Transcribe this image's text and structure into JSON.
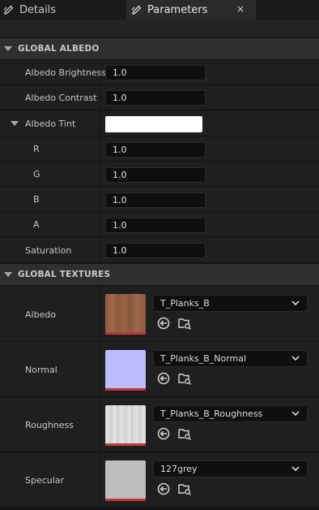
{
  "tabs": [
    {
      "label": "Details",
      "icon": "pencil-icon"
    },
    {
      "label": "Parameters",
      "icon": "pencil-icon",
      "close": "×"
    }
  ],
  "sections": {
    "albedo": {
      "title": "GLOBAL ALBEDO"
    },
    "textures": {
      "title": "GLOBAL TEXTURES"
    }
  },
  "albedo": {
    "brightness": {
      "label": "Albedo Brightness",
      "value": "1.0"
    },
    "contrast": {
      "label": "Albedo Contrast",
      "value": "1.0"
    },
    "tint": {
      "label": "Albedo Tint",
      "color": "#ffffff",
      "channels": [
        {
          "label": "R",
          "value": "1.0"
        },
        {
          "label": "G",
          "value": "1.0"
        },
        {
          "label": "B",
          "value": "1.0"
        },
        {
          "label": "A",
          "value": "1.0"
        }
      ]
    },
    "saturation": {
      "label": "Saturation",
      "value": "1.0"
    }
  },
  "textures": [
    {
      "label": "Albedo",
      "asset": "T_Planks_B",
      "thumb": "wood"
    },
    {
      "label": "Normal",
      "asset": "T_Planks_B_Normal",
      "thumb": "normal"
    },
    {
      "label": "Roughness",
      "asset": "T_Planks_B_Roughness",
      "thumb": "roughness"
    },
    {
      "label": "Specular",
      "asset": "127grey",
      "thumb": "grey"
    }
  ],
  "colors": {
    "accent": "#c0373a",
    "background": "#151515"
  }
}
